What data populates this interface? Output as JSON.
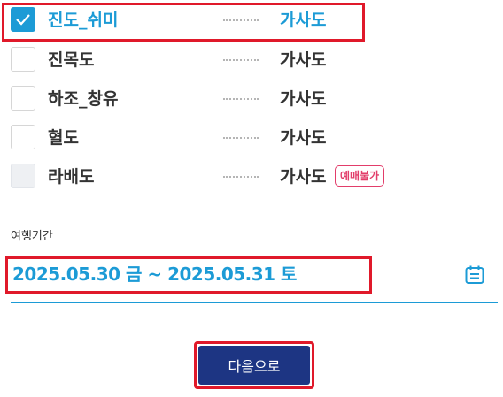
{
  "islands": [
    {
      "name": "진도_쉬미",
      "destination": "가사도",
      "checked": true,
      "disabled": false,
      "badge": ""
    },
    {
      "name": "진목도",
      "destination": "가사도",
      "checked": false,
      "disabled": false,
      "badge": ""
    },
    {
      "name": "하조_창유",
      "destination": "가사도",
      "checked": false,
      "disabled": false,
      "badge": ""
    },
    {
      "name": "혈도",
      "destination": "가사도",
      "checked": false,
      "disabled": false,
      "badge": ""
    },
    {
      "name": "라배도",
      "destination": "가사도",
      "checked": false,
      "disabled": true,
      "badge": "예매불가"
    }
  ],
  "period": {
    "label": "여행기간",
    "value": "2025.05.30 금 ~ 2025.05.31 토"
  },
  "next_button": "다음으로",
  "colors": {
    "accent": "#1c9bd6",
    "primary_button": "#1d3583",
    "badge": "#e23d6a",
    "highlight_box": "#e0192a"
  },
  "icons": {
    "check": "check-icon",
    "calendar": "calendar-icon"
  }
}
